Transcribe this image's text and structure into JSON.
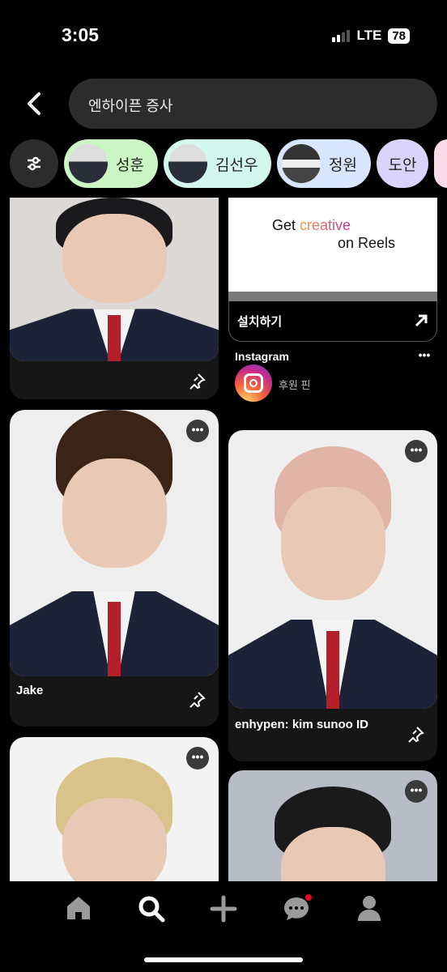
{
  "status": {
    "time": "3:05",
    "network": "LTE",
    "battery": "78"
  },
  "search": {
    "query": "엔하이픈 증사"
  },
  "chips": [
    {
      "label": "성훈",
      "color": "#c9f6c3"
    },
    {
      "label": "김선우",
      "color": "#d2f8ee"
    },
    {
      "label": "정원",
      "color": "#d7e6fb"
    },
    {
      "label": "도안",
      "color": "#dad3fb"
    }
  ],
  "pins": {
    "ad": {
      "headline_1": "Get ",
      "headline_accent": "creative",
      "headline_2": "on Reels",
      "cta": "설치하기",
      "advertiser": "Instagram",
      "sponsored": "후원 핀"
    },
    "jake": {
      "title": "Jake"
    },
    "sunoo": {
      "title": "enhypen: kim sunoo ID"
    }
  },
  "colors": {
    "accent_creative": "#d9447a",
    "chip_pink": "#fbd9e6",
    "notification": "#e60023"
  }
}
